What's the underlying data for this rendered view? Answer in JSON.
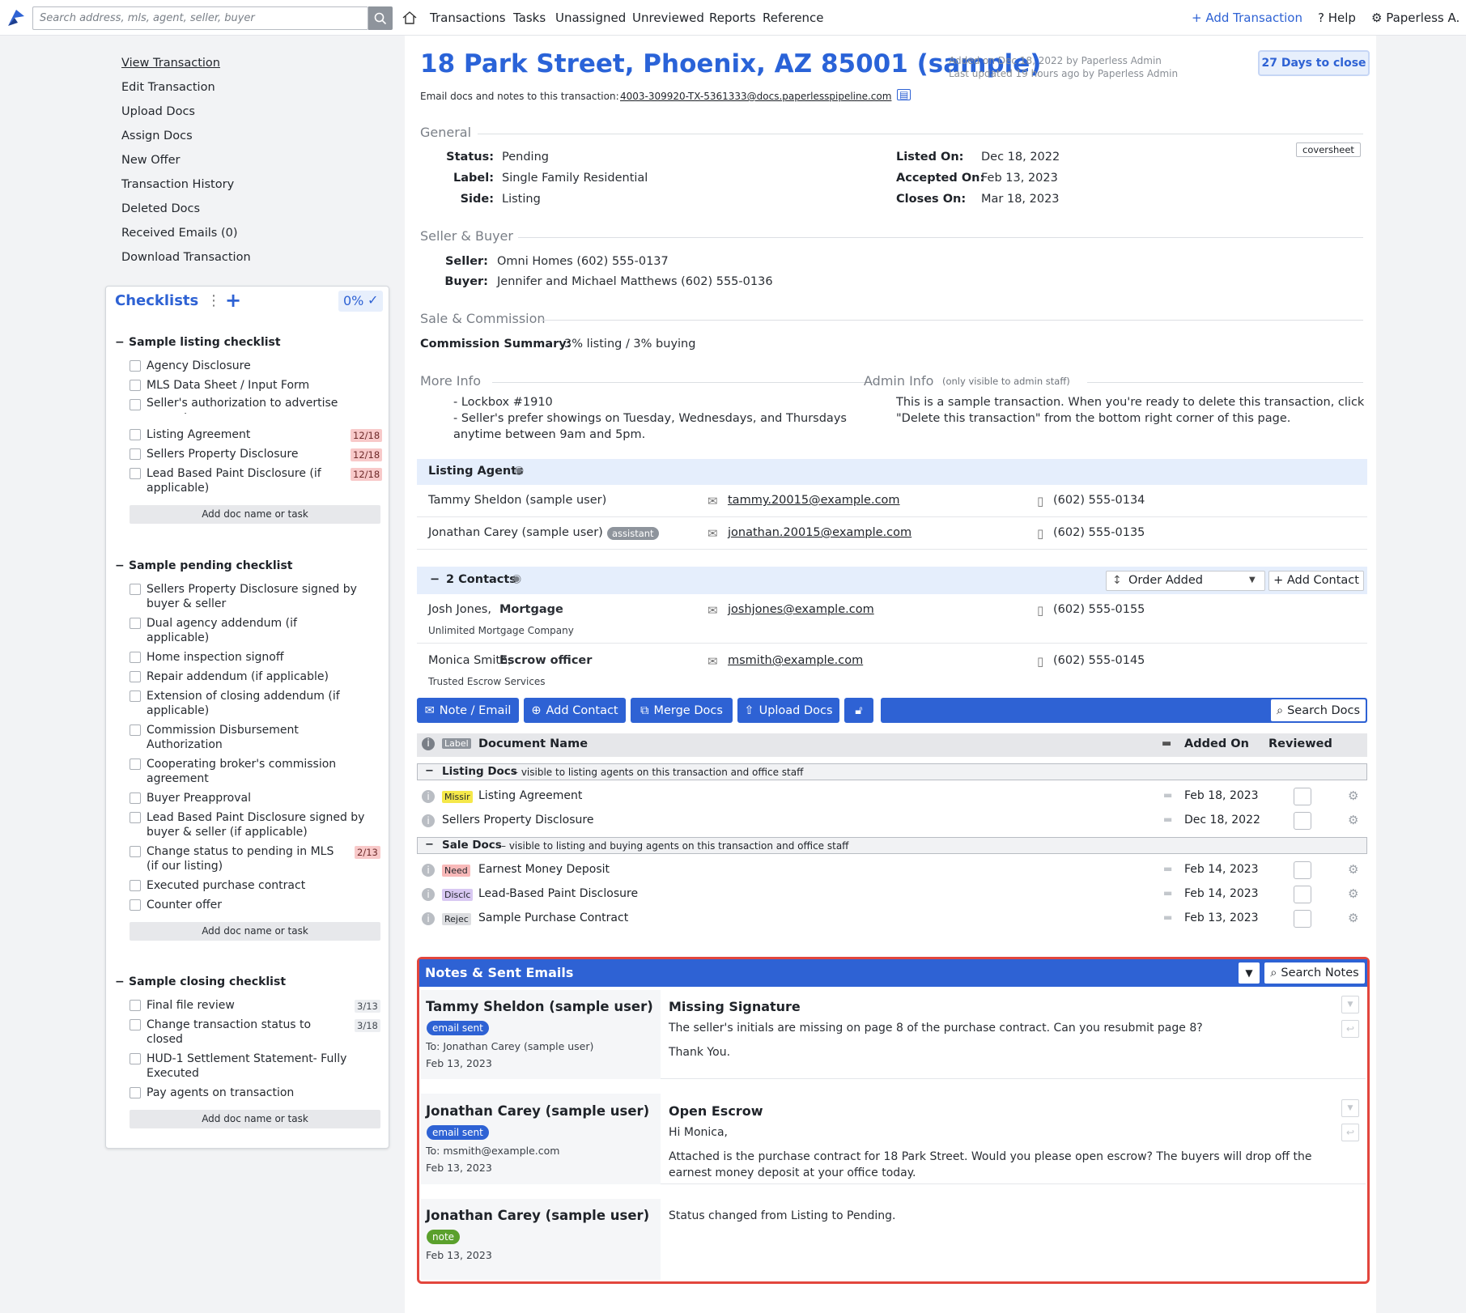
{
  "topbar": {
    "search_placeholder": "Search address, mls, agent, seller, buyer",
    "nav": [
      "Transactions",
      "Tasks",
      "Unassigned",
      "Unreviewed",
      "Reports",
      "Reference"
    ],
    "add_transaction": "Add Transaction",
    "help": "Help",
    "user": "Paperless A."
  },
  "left_links": [
    "View Transaction",
    "Edit Transaction",
    "Upload Docs",
    "Assign Docs",
    "New Offer",
    "Transaction History",
    "Deleted Docs",
    "Received Emails (0)",
    "Download Transaction"
  ],
  "checklists": {
    "title": "Checklists",
    "percent": "0%",
    "add_label": "Add doc name or task",
    "lists": [
      {
        "name": "Sample listing checklist",
        "items": [
          {
            "label": "Agency Disclosure",
            "badge": ""
          },
          {
            "label": "MLS Data Sheet / Input Form",
            "badge": ""
          },
          {
            "label": "Seller's authorization to advertise property",
            "badge": ""
          },
          {
            "label": "Listing Agreement",
            "badge": "12/18"
          },
          {
            "label": "Sellers Property Disclosure",
            "badge": "12/18"
          },
          {
            "label": "Lead Based Paint Disclosure (if applicable)",
            "badge": "12/18"
          }
        ]
      },
      {
        "name": "Sample pending checklist",
        "items": [
          {
            "label": "Sellers Property Disclosure signed by buyer & seller",
            "badge": ""
          },
          {
            "label": "Dual agency addendum (if applicable)",
            "badge": ""
          },
          {
            "label": "Home inspection signoff",
            "badge": ""
          },
          {
            "label": "Repair addendum (if applicable)",
            "badge": ""
          },
          {
            "label": "Extension of closing addendum (if applicable)",
            "badge": ""
          },
          {
            "label": "Commission Disbursement Authorization",
            "badge": ""
          },
          {
            "label": "Cooperating broker's commission agreement",
            "badge": ""
          },
          {
            "label": "Buyer Preapproval",
            "badge": ""
          },
          {
            "label": "Lead Based Paint Disclosure signed by buyer & seller (if applicable)",
            "badge": ""
          },
          {
            "label": "Change status to pending in MLS (if our listing)",
            "badge": "2/13"
          },
          {
            "label": "Executed purchase contract",
            "badge": ""
          },
          {
            "label": "Counter offer",
            "badge": ""
          }
        ]
      },
      {
        "name": "Sample closing checklist",
        "items": [
          {
            "label": "Final file review",
            "badge": "3/13"
          },
          {
            "label": "Change transaction status to closed",
            "badge": "3/18"
          },
          {
            "label": "HUD-1 Settlement Statement- Fully Executed",
            "badge": ""
          },
          {
            "label": "Pay agents on transaction",
            "badge": ""
          }
        ]
      }
    ]
  },
  "header": {
    "title": "18 Park Street, Phoenix, AZ 85001 (sample)",
    "added": "Added on Dec 18, 2022 by Paperless Admin",
    "updated": "Last updated 19 hours ago by Paperless Admin",
    "days": "27 Days to close",
    "email_prefix": "Email docs and notes to this transaction:",
    "email": "4003-309920-TX-5361333@docs.paperlesspipeline.com"
  },
  "general": {
    "title": "General",
    "coversheet": "coversheet",
    "status_l": "Status:",
    "status": "Pending",
    "label_l": "Label:",
    "label": "Single Family Residential",
    "side_l": "Side:",
    "side": "Listing",
    "listed_l": "Listed On:",
    "listed": "Dec 18, 2022",
    "accepted_l": "Accepted On:",
    "accepted": "Feb 13, 2023",
    "closes_l": "Closes On:",
    "closes": "Mar 18, 2023"
  },
  "seller_buyer": {
    "title": "Seller & Buyer",
    "seller_l": "Seller:",
    "seller": "Omni Homes (602) 555-0137",
    "buyer_l": "Buyer:",
    "buyer": "Jennifer and Michael Matthews (602) 555-0136"
  },
  "commission": {
    "title": "Sale & Commission",
    "label": "Commission Summary:",
    "value": "3% listing / 3% buying"
  },
  "more_info": {
    "title": "More Info",
    "line1": "- Lockbox #1910",
    "line2": "- Seller's prefer showings on Tuesday, Wednesdays, and Thursdays",
    "line3": "anytime between 9am and 5pm."
  },
  "admin_info": {
    "title": "Admin Info",
    "note": "(only visible to admin staff)",
    "line1": "This is a sample transaction. When you're ready to delete this transaction, click",
    "line2": "\"Delete this transaction\" from the bottom right corner of this page."
  },
  "listing_agents": {
    "title": "Listing Agents",
    "agents": [
      {
        "name": "Tammy Sheldon (sample user)",
        "tag": "",
        "email": "tammy.20015@example.com",
        "phone": "(602) 555-0134"
      },
      {
        "name": "Jonathan Carey (sample user)",
        "tag": "assistant",
        "email": "jonathan.20015@example.com",
        "phone": "(602) 555-0135"
      }
    ]
  },
  "contacts": {
    "title": "2 Contacts",
    "order": "Order Added",
    "add": "+ Add Contact",
    "items": [
      {
        "name": "Josh Jones,",
        "role": "Mortgage",
        "company": "Unlimited Mortgage Company",
        "email": "joshjones@example.com",
        "phone": "(602) 555-0155"
      },
      {
        "name": "Monica Smith,",
        "role": "Escrow officer",
        "company": "Trusted Escrow Services",
        "email": "msmith@example.com",
        "phone": "(602) 555-0145"
      }
    ]
  },
  "toolbar": {
    "note": "Note / Email",
    "add_contact": "Add Contact",
    "merge": "Merge Docs",
    "upload": "Upload Docs",
    "search": "Search Docs"
  },
  "docs": {
    "label_col": "Label",
    "name_col": "Document Name",
    "added_col": "Added On",
    "reviewed_col": "Reviewed",
    "groups": [
      {
        "name": "Listing Docs",
        "desc": "– visible to listing agents on this transaction and office staff",
        "rows": [
          {
            "tag": "Missir",
            "name": "Listing Agreement",
            "date": "Feb 18, 2023"
          },
          {
            "tag": "",
            "name": "Sellers Property Disclosure",
            "date": "Dec 18, 2022"
          }
        ]
      },
      {
        "name": "Sale Docs",
        "desc": "– visible to listing and buying agents on this transaction and office staff",
        "rows": [
          {
            "tag": "Need",
            "name": "Earnest Money Deposit",
            "date": "Feb 14, 2023"
          },
          {
            "tag": "Disclc",
            "name": "Lead-Based Paint Disclosure",
            "date": "Feb 14, 2023"
          },
          {
            "tag": "Rejec",
            "name": "Sample Purchase Contract",
            "date": "Feb 13, 2023"
          }
        ]
      }
    ]
  },
  "notes": {
    "title": "Notes & Sent Emails",
    "search": "Search Notes",
    "items": [
      {
        "author": "Tammy Sheldon (sample user)",
        "type": "email sent",
        "to": "To: Jonathan Carey (sample user)",
        "date": "Feb 13, 2023",
        "subject": "Missing Signature",
        "body1": "The seller's initials are missing on page 8 of the purchase contract. Can you resubmit page 8?",
        "body2": "Thank You.",
        "body3": ""
      },
      {
        "author": "Jonathan Carey (sample user)",
        "type": "email sent",
        "to": "To: msmith@example.com",
        "date": "Feb 13, 2023",
        "subject": "Open Escrow",
        "body1": "Hi Monica,",
        "body2": "Attached is the purchase contract for 18 Park Street. Would you please open escrow? The buyers will drop off the",
        "body3": "earnest money deposit at your office today."
      },
      {
        "author": "Jonathan Carey (sample user)",
        "type": "note",
        "to": "",
        "date": "Feb 13, 2023",
        "subject": "",
        "body1": "Status changed from Listing to Pending.",
        "body2": "",
        "body3": ""
      }
    ]
  },
  "colors": {
    "brand": "#2e62d4",
    "title": "#2a63d8",
    "highlight": "#e2463d",
    "tag_missing": "#f5e84a",
    "tag_need": "#f8b9b9",
    "tag_disc": "#d8c8f2",
    "tag_rejec": "#dcdde0",
    "note_green": "#5aa02c"
  }
}
